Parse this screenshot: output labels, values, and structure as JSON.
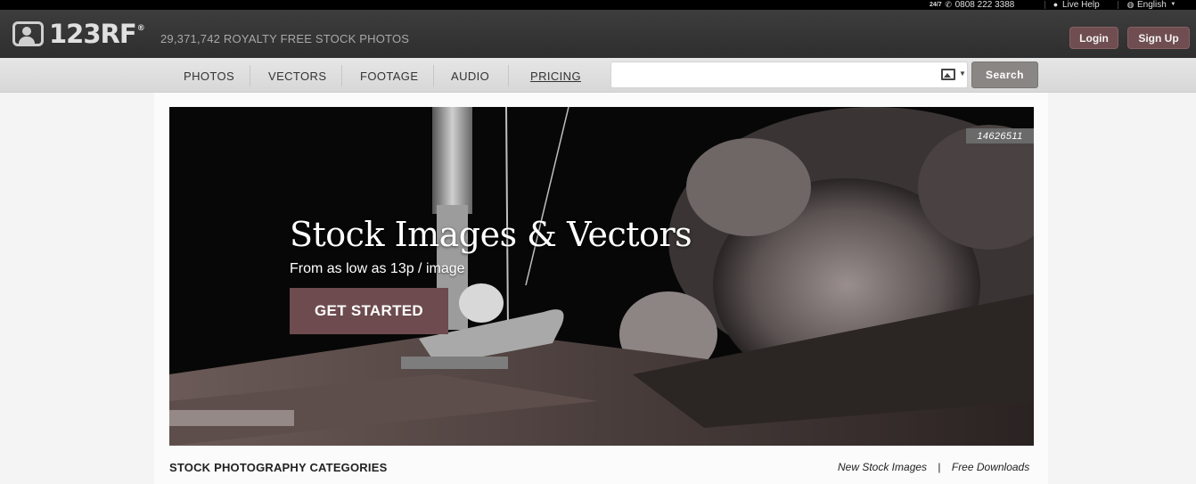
{
  "topbar": {
    "phone_prefix": "24/7",
    "phone_number": "0808 222 3388",
    "live_help": "Live Help",
    "language": "English",
    "icons": [
      "phone-icon",
      "chat-bubble-icon",
      "globe-icon",
      "chevron-down-icon"
    ]
  },
  "header": {
    "logo_text": "123RF",
    "logo_reg": "®",
    "stock_count": "29,371,742",
    "stock_label": "ROYALTY FREE STOCK PHOTOS",
    "login_label": "Login",
    "signup_label": "Sign Up",
    "accent_color": "#6f4d50"
  },
  "nav": {
    "items": [
      {
        "label": "PHOTOS"
      },
      {
        "label": "VECTORS"
      },
      {
        "label": "FOOTAGE"
      },
      {
        "label": "AUDIO"
      },
      {
        "label": "PRICING"
      }
    ],
    "search": {
      "value": "",
      "placeholder": "",
      "button_label": "Search",
      "icons": [
        "image-search-icon",
        "caret-down-icon"
      ]
    }
  },
  "hero": {
    "image_id": "14626511",
    "title": "Stock Images & Vectors",
    "subtitle": "From as low as 13p / image",
    "cta_label": "GET STARTED",
    "cta_color": "#6e4b4e"
  },
  "footer_row": {
    "categories_title": "STOCK PHOTOGRAPHY CATEGORIES",
    "link_new": "New Stock Images",
    "divider": "|",
    "link_free": "Free Downloads"
  }
}
